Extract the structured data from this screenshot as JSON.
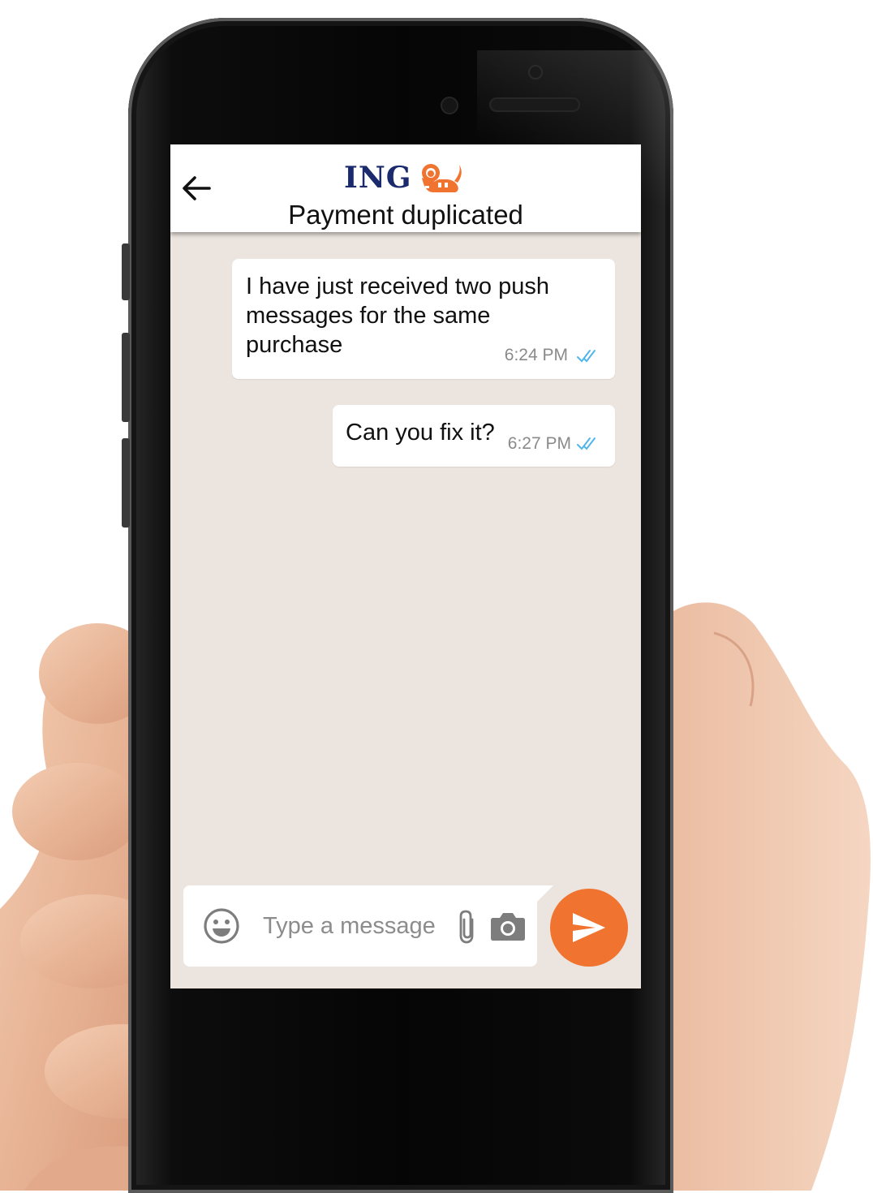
{
  "header": {
    "brand": "ING",
    "title": "Payment duplicated"
  },
  "messages": [
    {
      "text": "I have just received two push messages for the same purchase",
      "time": "6:24 PM",
      "status": "read"
    },
    {
      "text": "Can you fix it?",
      "time": "6:27 PM",
      "status": "read"
    }
  ],
  "composer": {
    "placeholder": "Type a message",
    "value": ""
  },
  "icons": {
    "back": "arrow-left-icon",
    "emoji": "smiley-icon",
    "attach": "paperclip-icon",
    "camera": "camera-icon",
    "send": "send-icon",
    "read": "double-check-icon"
  },
  "colors": {
    "brand_orange": "#f07430",
    "brand_navy": "#1a2a6c",
    "chat_background": "#ece5df",
    "read_tick": "#4fb6ec"
  }
}
